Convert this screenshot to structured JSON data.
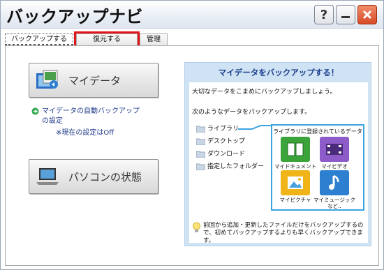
{
  "window": {
    "title": "バックアップナビ"
  },
  "titlebar_buttons": {
    "help": "?",
    "minimize": "minimize-icon",
    "close": "close-icon"
  },
  "tabs": [
    {
      "label": "バックアップする",
      "state": "active"
    },
    {
      "label": "復元する",
      "state": "highlighted"
    },
    {
      "label": "管理",
      "state": "normal"
    }
  ],
  "left": {
    "mydata_button": {
      "label": "マイデータ",
      "icon": "mydata-icon"
    },
    "auto_backup_link": {
      "line1": "マイデータの自動バックアップ",
      "line2": "の設定",
      "icon": "green-arrow-icon"
    },
    "current_setting": "※現在の設定はOff",
    "pc_status_button": {
      "label": "パソコンの状態",
      "icon": "laptop-icon"
    }
  },
  "panel": {
    "title": "マイデータをバックアップする！",
    "intro": "大切なデータをこまめにバックアップしましょう。",
    "subtitle": "次のようなデータをバックアップします。",
    "folders": [
      "ライブラリ",
      "デスクトップ",
      "ダウンロード",
      "指定したフォルダー"
    ],
    "library": {
      "title": "ライブラリに登録されているデータ",
      "items": [
        {
          "caption": "マイドキュメント",
          "color": "#3aa33a"
        },
        {
          "caption": "マイビデオ",
          "color": "#8e5cc9"
        },
        {
          "caption": "マイピクチャ",
          "color": "#f0b418"
        },
        {
          "caption": "マイミュージック",
          "caption2": "など..",
          "color": "#2d7fd0"
        }
      ]
    },
    "hint": "前回から追加・更新したファイルだけをバックアップするので、初めてバックアップするよりも早くバックアップできます。"
  },
  "colors": {
    "highlight": "#e0161c",
    "accent": "#3ba3e0",
    "link": "#1f3a8a"
  }
}
